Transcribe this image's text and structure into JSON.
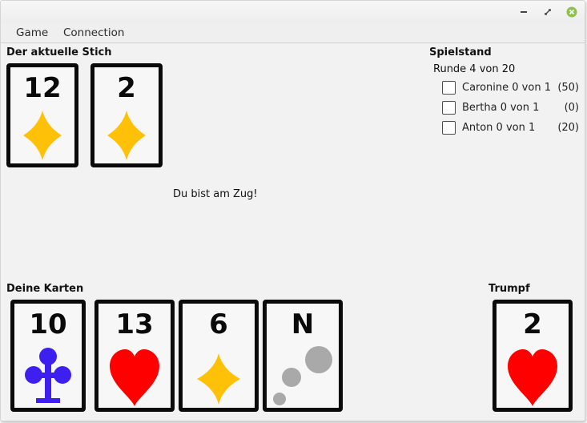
{
  "titlebar": {
    "buttons": [
      "minimize-icon",
      "maximize-icon",
      "close-icon"
    ],
    "close_color": "#8bc34a"
  },
  "menu": {
    "game": "Game",
    "connection": "Connection"
  },
  "trick": {
    "label": "Der aktuelle Stich",
    "cards": [
      {
        "value": "12",
        "suit": "diamond"
      },
      {
        "value": "2",
        "suit": "diamond"
      }
    ]
  },
  "status": {
    "message": "Du bist am Zug!"
  },
  "score": {
    "label": "Spielstand",
    "round": "Runde 4 von 20",
    "players": [
      {
        "name": "Caronine 0 von 1",
        "points": "(50)",
        "checked": false
      },
      {
        "name": "Bertha 0 von 1",
        "points": "(0)",
        "checked": false
      },
      {
        "name": "Anton 0 von 1",
        "points": "(20)",
        "checked": false
      }
    ]
  },
  "hand": {
    "label": "Deine Karten",
    "cards": [
      {
        "value": "10",
        "suit": "club"
      },
      {
        "value": "13",
        "suit": "heart"
      },
      {
        "value": "6",
        "suit": "diamond"
      },
      {
        "value": "N",
        "suit": "bubbles"
      }
    ]
  },
  "trump": {
    "label": "Trumpf",
    "card": {
      "value": "2",
      "suit": "heart"
    }
  },
  "colors": {
    "diamond": "#ffc107",
    "heart": "#ff0000",
    "club": "#3d1ff0",
    "bubbles": "#a9a9a9"
  }
}
